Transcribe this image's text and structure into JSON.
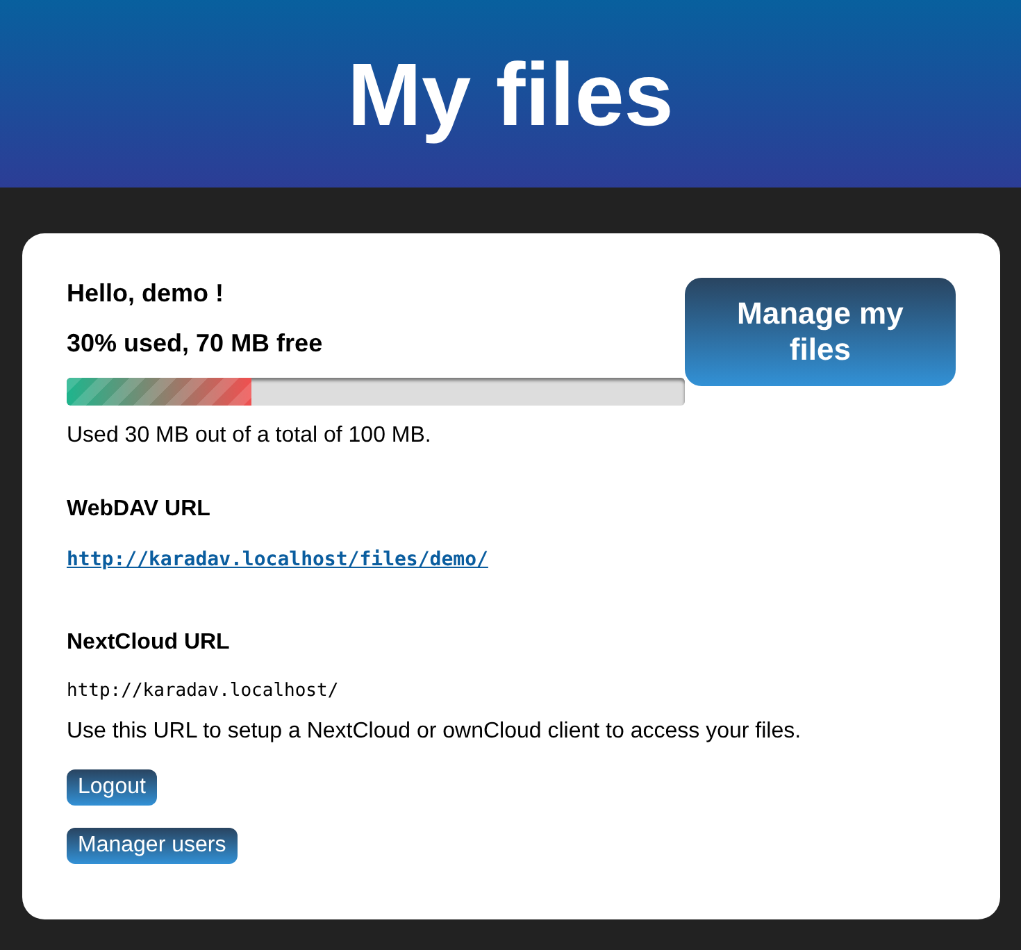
{
  "header": {
    "title": "My files"
  },
  "account": {
    "greeting": "Hello, demo !",
    "usage_summary": "30% used, 70 MB free",
    "quota": {
      "level": 0.3
    },
    "usage_detail": "Used 30 MB out of a total of 100 MB.",
    "manage_button": "Manage my files"
  },
  "webdav": {
    "heading": "WebDAV URL",
    "url": "http://karadav.localhost/files/demo/"
  },
  "nextcloud": {
    "heading": "NextCloud URL",
    "url": "http://karadav.localhost/",
    "note": "Use this URL to setup a NextCloud or ownCloud client to access your files."
  },
  "buttons": [
    "Logout",
    "Manager users"
  ]
}
